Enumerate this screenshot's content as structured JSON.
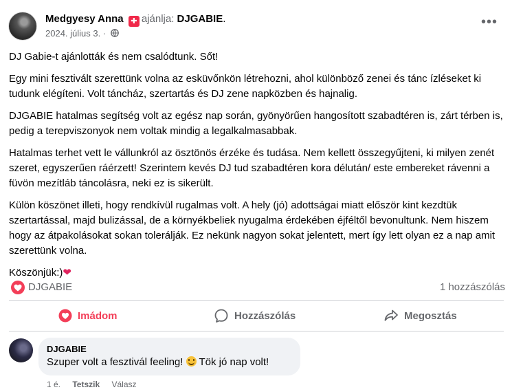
{
  "post": {
    "author": "Medgyesy Anna",
    "recommends_label": "ajánlja:",
    "page_name": "DJGABIE",
    "page_suffix": ".",
    "date": "2024. július 3.",
    "separator": "·",
    "more_icon": "more-icon",
    "paragraphs": [
      "DJ Gabie-t  ajánlották és nem csalódtunk. Sőt!",
      "Egy mini fesztivált szerettünk volna az esküvőnkön létrehozni, ahol különböző zenei és tánc ízléseket ki tudunk elégíteni. Volt táncház, szertartás és DJ zene napközben és hajnalig.",
      "DJGABIE hatalmas segítség volt az egész nap során, gyönyörűen hangosított szabadtéren is, zárt térben is, pedig a terepviszonyok nem voltak mindig a legalkalmasabbak.",
      "Hatalmas terhet vett le vállunkról az ösztönös érzéke és tudása. Nem kellett  összegyűjteni, ki milyen zenét szeret, egyszerűen ráérzett! Szerintem kevés DJ tud szabadtéren kora délután/ este embereket rávenni a füvön mezítláb táncolásra, neki ez is sikerült.",
      "Külön köszönet illeti, hogy rendkívül rugalmas volt. A hely (jó) adottságai miatt először kint kezdtük szertartással, majd bulizással, de a környékbeliek nyugalma érdekében éjféltől bevonultunk. Nem hiszem hogy az átpakolásokat sokan tolerálják. Ez nekünk nagyon sokat jelentett, mert így lett olyan ez a nap amit szerettünk volna."
    ],
    "closing": "Köszönjük:)",
    "closing_emoji": "❤"
  },
  "stats": {
    "reaction_name": "DJGABIE",
    "comment_count": "1 hozzászólás"
  },
  "actions": {
    "like": "Imádom",
    "comment": "Hozzászólás",
    "share": "Megosztás"
  },
  "comment": {
    "author": "DJGABIE",
    "text": "Szuper volt a fesztivál feeling! ",
    "text_after": " Tök jó nap volt!",
    "time": "1 é.",
    "like": "Tetszik",
    "reply": "Válasz"
  },
  "colors": {
    "accent_love": "#f33e58",
    "secondary_text": "#65676b",
    "bubble_bg": "#f0f2f5"
  }
}
